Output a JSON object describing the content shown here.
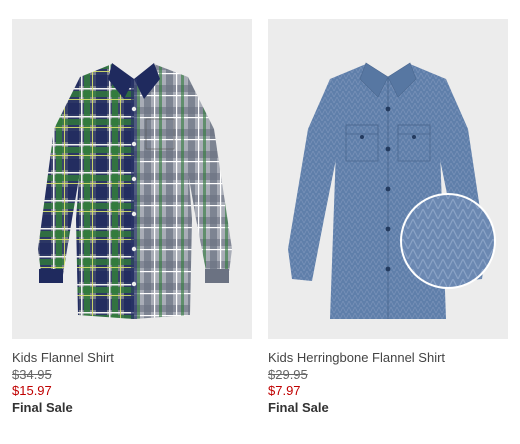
{
  "products": [
    {
      "name": "Kids Flannel Shirt",
      "original_price": "$34.95",
      "sale_price": "$15.97",
      "sale_note": "Final Sale",
      "image": "plaid-flannel-shirt"
    },
    {
      "name": "Kids Herringbone Flannel Shirt",
      "original_price": "$29.95",
      "sale_price": "$7.97",
      "sale_note": "Final Sale",
      "image": "blue-herringbone-shirt-with-fabric-zoom"
    }
  ],
  "colors": {
    "sale_price": "#c00000",
    "image_background": "#ececec",
    "plaid_navy": "#1f2a5e",
    "plaid_green": "#2f7a3a",
    "herringbone_blue": "#5f7faa"
  }
}
